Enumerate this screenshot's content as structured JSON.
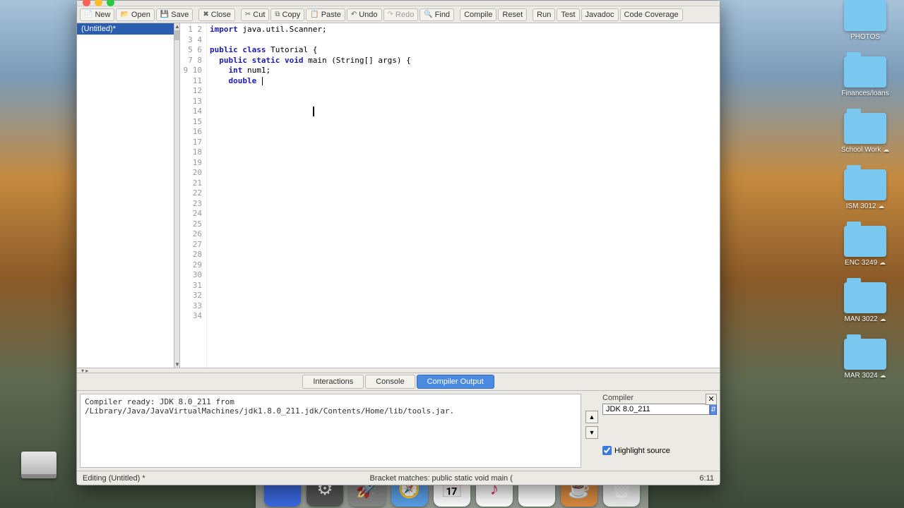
{
  "desktop": {
    "folders": [
      "PHOTOS",
      "Finances/loans",
      "School Work",
      "ISM 3012",
      "ENC 3249",
      "MAN 3022",
      "MAR 3024"
    ]
  },
  "toolbar": {
    "new": "New",
    "open": "Open",
    "save": "Save",
    "close": "Close",
    "cut": "Cut",
    "copy": "Copy",
    "paste": "Paste",
    "undo": "Undo",
    "redo": "Redo",
    "find": "Find",
    "compile": "Compile",
    "reset": "Reset",
    "run": "Run",
    "test": "Test",
    "javadoc": "Javadoc",
    "coverage": "Code Coverage"
  },
  "file_tab": "(Untitled)*",
  "code": {
    "l1a": "import",
    "l1b": " java.util.Scanner;",
    "l3a": "public class",
    "l3b": " Tutorial {",
    "l4a": "  public static void",
    "l4b": " main (String[] args) {",
    "l5a": "    int",
    "l5b": " num1;",
    "l6a": "    double",
    "l6b": " "
  },
  "line_count": 34,
  "tabs": {
    "interactions": "Interactions",
    "console": "Console",
    "output": "Compiler Output"
  },
  "console_text": "Compiler ready: JDK 8.0_211 from\n/Library/Java/JavaVirtualMachines/jdk1.8.0_211.jdk/Contents/Home/lib/tools.jar.",
  "compiler": {
    "label": "Compiler",
    "value": "JDK 8.0_211",
    "highlight": "Highlight source"
  },
  "status": {
    "left": "Editing (Untitled) *",
    "mid": "Bracket matches:   public static void main (",
    "right": "6:11"
  }
}
